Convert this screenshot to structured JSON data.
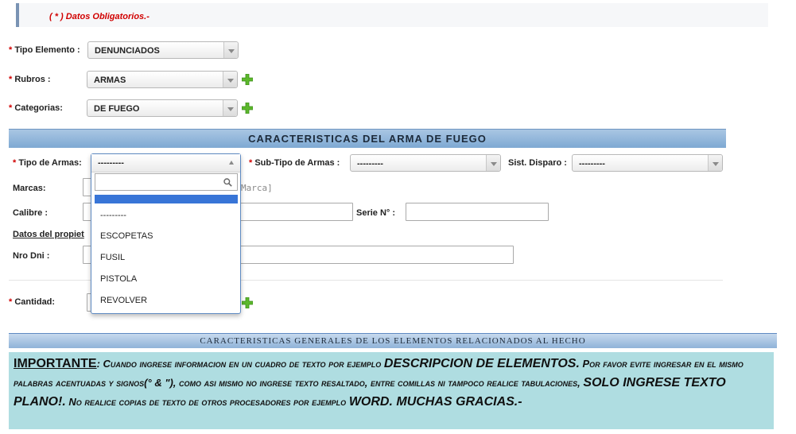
{
  "notice": {
    "text": "( * ) Datos Obligatorios.-"
  },
  "required_mark": "*",
  "form": {
    "tipo_elemento": {
      "label": "Tipo Elemento :",
      "value": "DENUNCIADOS"
    },
    "rubros": {
      "label": "Rubros :",
      "value": "ARMAS"
    },
    "categorias": {
      "label": "Categorias:",
      "value": "DE FUEGO"
    }
  },
  "section_title": "CARACTERISTICAS DEL ARMA DE FUEGO",
  "arma": {
    "tipo_armas": {
      "label": "Tipo de Armas:",
      "value": "---------"
    },
    "sub_tipo": {
      "label": "Sub-Tipo de Armas :",
      "value": "---------"
    },
    "sist_disparo": {
      "label": "Sist. Disparo :",
      "value": "---------"
    },
    "marcas": {
      "label": "Marcas:",
      "placeholder_tail": "Marca]"
    },
    "calibre": {
      "label": "Calibre :"
    },
    "serie": {
      "label": "Serie N° :"
    },
    "datos_propietario": {
      "label": "Datos del propiet"
    },
    "nro_dni": {
      "label": "Nro Dni :"
    },
    "cantidad": {
      "label": "Cantidad:"
    }
  },
  "dropdown": {
    "selected": "---------",
    "search_value": "",
    "options": [
      "---------",
      "ESCOPETAS",
      "FUSIL",
      "PISTOLA",
      "REVOLVER"
    ]
  },
  "section2_title": "CARACTERISTICAS GENERALES DE LOS ELEMENTOS RELACIONADOS AL HECHO",
  "important": {
    "heading": "IMPORTANTE",
    "p1": "Cuando ingrese informacion en un cuadro de texto por ejemplo",
    "p2": "DESCRIPCION DE ELEMENTOS.",
    "p3": "Por favor evite ingresar en el mismo palabras acentuadas y signos(° & \"), como asi mismo no ingrese texto resaltado, entre comillas ni tampoco realice tabulaciones,",
    "p4": "SOLO INGRESE TEXTO PLANO!.",
    "p5": "No realice copias de texto de otros procesadores por ejemplo",
    "p6": "WORD. MUCHAS GRACIAS.-"
  },
  "colors": {
    "required": "#d10000",
    "section_bar": "#7ea9d3",
    "important_bg": "#afdde1",
    "plus_icon": "#5cb82c"
  }
}
